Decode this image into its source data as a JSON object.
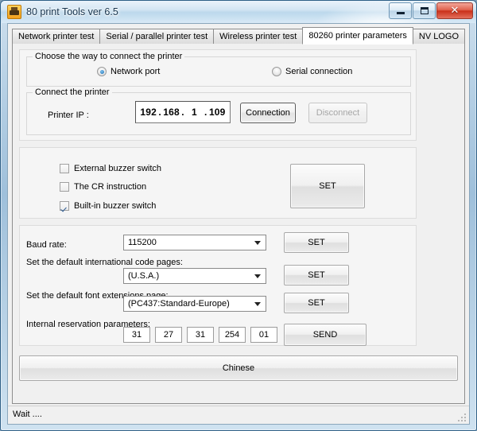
{
  "window": {
    "title": "80 print Tools ver 6.5",
    "icon": "printer-icon",
    "minimize_label": "–",
    "maximize_label": "□",
    "close_label": "✕"
  },
  "tabs": [
    {
      "label": "Network printer test",
      "active": false
    },
    {
      "label": "Serial / parallel printer test",
      "active": false
    },
    {
      "label": "Wireless printer test",
      "active": false
    },
    {
      "label": "80260 printer parameters",
      "active": true
    },
    {
      "label": "NV LOGO",
      "active": false
    }
  ],
  "connect_method": {
    "group_title": "Choose the way to connect the printer",
    "options": [
      {
        "label": "Network port",
        "selected": true
      },
      {
        "label": "Serial connection",
        "selected": false
      }
    ]
  },
  "connect_printer": {
    "group_title": "Connect the printer",
    "ip_label": "Printer IP :",
    "ip_segments": [
      "192",
      "168",
      "1",
      "109"
    ],
    "connect_button": "Connection",
    "disconnect_button": "Disconnect",
    "disconnect_disabled": true
  },
  "switches": {
    "items": [
      {
        "label": "External buzzer switch",
        "checked": false
      },
      {
        "label": "The CR instruction",
        "checked": false
      },
      {
        "label": "Built-in buzzer switch",
        "checked": true
      }
    ],
    "set_button": "SET"
  },
  "settings": {
    "baud_label": "Baud rate:",
    "baud_value": "115200",
    "codepage_label": "Set the default international code pages:",
    "codepage_value": "(U.S.A.)",
    "fontpage_label": "Set the default font extensions page:",
    "fontpage_value": "(PC437:Standard-Europe)",
    "set_button_1": "SET",
    "set_button_2": "SET",
    "set_button_3": "SET",
    "reservation_label": "Internal reservation parameters:",
    "reservation_values": [
      "31",
      "27",
      "31",
      "254",
      "01"
    ],
    "send_button": "SEND"
  },
  "language_button": "Chinese",
  "status": "Wait ...."
}
